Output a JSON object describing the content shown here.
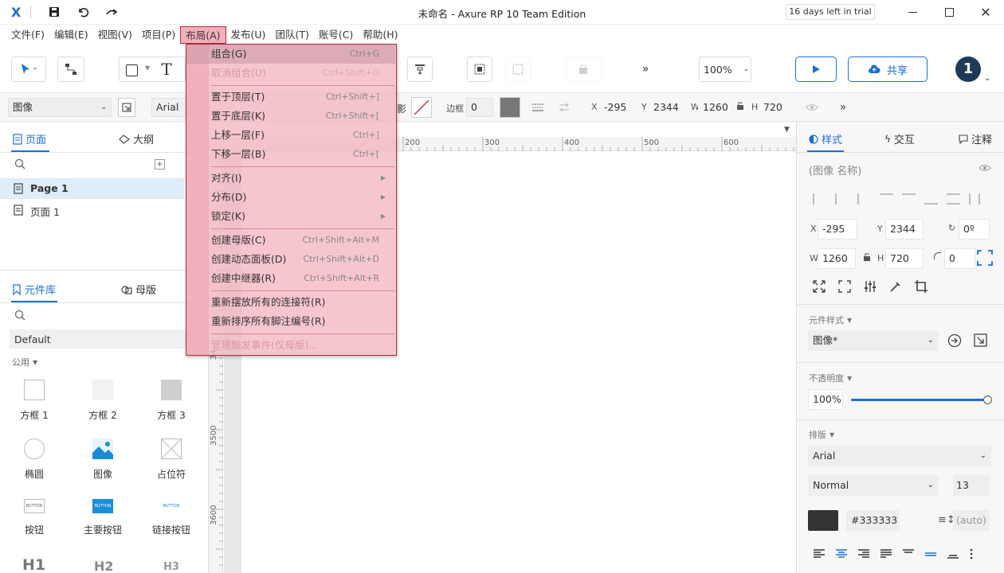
{
  "window": {
    "title": "未命名 - Axure RP 10 Team Edition",
    "trial": "16 days left in trial",
    "logo": "X"
  },
  "menubar": {
    "items": [
      "文件(F)",
      "编辑(E)",
      "视图(V)",
      "项目(P)",
      "布局(A)",
      "发布(U)",
      "团队(T)",
      "账号(C)",
      "帮助(H)"
    ]
  },
  "toolbar": {
    "zoom": "100%",
    "share_label": "共享",
    "avatar": "1",
    "more": "»"
  },
  "propbar": {
    "style_select": "图像",
    "font": "Arial",
    "shadow_label": "影",
    "border_label": "边框",
    "border_value": "0",
    "x_label": "X",
    "x_value": "-295",
    "y_label": "Y",
    "y_value": "2344",
    "w_label": "W",
    "w_value": "1260",
    "h_label": "H",
    "h_value": "720"
  },
  "left": {
    "pages_tab": "页面",
    "outline_tab": "大纲",
    "pages": [
      "Page 1",
      "页面 1"
    ],
    "library_tab": "元件库",
    "masters_tab": "母版",
    "library_select": "Default",
    "group_label": "公用",
    "widgets": [
      {
        "label": "方框 1"
      },
      {
        "label": "方框 2"
      },
      {
        "label": "方框 3"
      },
      {
        "label": "椭圆"
      },
      {
        "label": "图像"
      },
      {
        "label": "占位符"
      },
      {
        "label": "按钮"
      },
      {
        "label": "主要按钮"
      },
      {
        "label": "链接按钮"
      }
    ],
    "button_text": "BUTTON",
    "headings": [
      "H1",
      "H2",
      "H3"
    ]
  },
  "ruler": {
    "h_ticks": [
      "200",
      "300",
      "400",
      "500",
      "600"
    ],
    "v_ticks": [
      "34",
      "3500",
      "3600"
    ]
  },
  "right": {
    "style_tab": "样式",
    "interact_tab": "交互",
    "notes_tab": "注释",
    "name_placeholder": "(图像 名称)",
    "x_label": "X",
    "x_value": "-295",
    "y_label": "Y",
    "y_value": "2344",
    "rot_value": "0º",
    "w_label": "W",
    "w_value": "1260",
    "h_label": "H",
    "h_value": "720",
    "radius_value": "0",
    "widget_style_label": "元件样式",
    "widget_style_value": "图像*",
    "opacity_label": "不透明度",
    "opacity_value": "100%",
    "opacity_fraction": 1.0,
    "typography_label": "排版",
    "font_value": "Arial",
    "weight_value": "Normal",
    "size_value": "13",
    "color_value": "#333333",
    "line_height_value": "(auto)"
  },
  "dropdown": {
    "items": [
      {
        "label": "组合(G)",
        "shortcut": "Ctrl+G",
        "disabled": false,
        "hover": true
      },
      {
        "label": "取消组合(U)",
        "shortcut": "Ctrl+Shift+G",
        "disabled": true
      },
      {
        "label": "置于顶层(T)",
        "shortcut": "Ctrl+Shift+]",
        "disabled": false
      },
      {
        "label": "置于底层(K)",
        "shortcut": "Ctrl+Shift+[",
        "disabled": false
      },
      {
        "label": "上移一层(F)",
        "shortcut": "Ctrl+]",
        "disabled": false
      },
      {
        "label": "下移一层(B)",
        "shortcut": "Ctrl+[",
        "disabled": false
      },
      {
        "label": "对齐(I)",
        "submenu": true
      },
      {
        "label": "分布(D)",
        "submenu": true
      },
      {
        "label": "锁定(K)",
        "submenu": true
      },
      {
        "label": "创建母版(C)",
        "shortcut": "Ctrl+Shift+Alt+M"
      },
      {
        "label": "创建动态面板(D)",
        "shortcut": "Ctrl+Shift+Alt+D"
      },
      {
        "label": "创建中继器(R)",
        "shortcut": "Ctrl+Shift+Alt+R"
      },
      {
        "label": "重新摆放所有的连接符(R)"
      },
      {
        "label": "重新排序所有脚注编号(R)"
      },
      {
        "label": "管理触发事件(仅母版)...",
        "disabled": true
      }
    ]
  },
  "colors": {
    "accent": "#1b6fd3",
    "avatar_bg": "#1e3a56",
    "menu_overlay": "#f3b0bb",
    "menu_border": "#a8303f",
    "fill_swatch": "#777777",
    "text_swatch": "#333333"
  }
}
